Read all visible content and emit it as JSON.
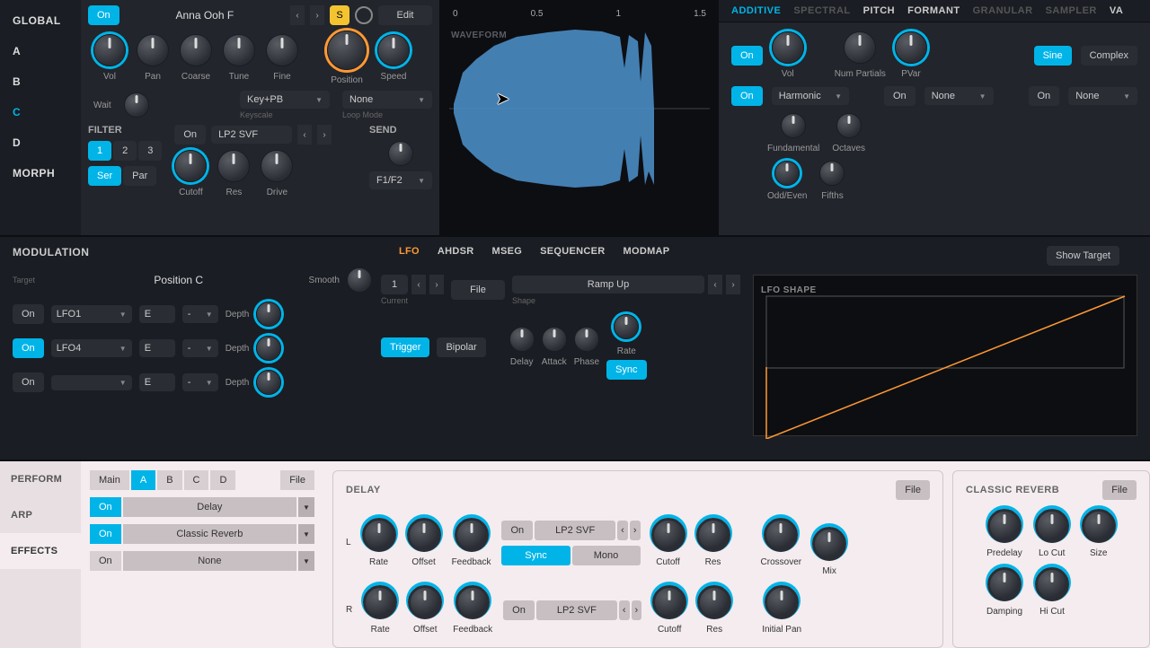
{
  "sidebar": {
    "items": [
      "GLOBAL",
      "A",
      "B",
      "C",
      "D",
      "MORPH"
    ],
    "active": 3
  },
  "source": {
    "on": "On",
    "preset": "Anna Ooh F",
    "s_btn": "S",
    "edit": "Edit",
    "knobs1": [
      "Vol",
      "Pan",
      "Coarse",
      "Tune",
      "Fine",
      "Position",
      "Speed"
    ],
    "wait": "Wait",
    "keyscale": {
      "value": "Key+PB",
      "label": "Keyscale"
    },
    "loopmode": {
      "value": "None",
      "label": "Loop Mode"
    },
    "filter": {
      "title": "FILTER",
      "nums": [
        "1",
        "2",
        "3"
      ],
      "ser": "Ser",
      "par": "Par",
      "on": "On",
      "type": "LP2 SVF",
      "knobs": [
        "Cutoff",
        "Res",
        "Drive"
      ]
    },
    "send": {
      "title": "SEND",
      "route": "F1/F2"
    }
  },
  "waveform": {
    "ticks": [
      "0",
      "0.5",
      "1",
      "1.5"
    ],
    "label": "WAVEFORM"
  },
  "engine": {
    "tabs": [
      "ADDITIVE",
      "SPECTRAL",
      "PITCH",
      "FORMANT",
      "GRANULAR",
      "SAMPLER",
      "VA"
    ],
    "active": 0,
    "mode": {
      "sine": "Sine",
      "complex": "Complex"
    },
    "row1_on": "On",
    "row1_knobs": [
      "Vol",
      "Num Partials",
      "PVar"
    ],
    "row2_on": "On",
    "harmonic": "Harmonic",
    "row2b_on": "On",
    "row2b_val": "None",
    "row2c_on": "On",
    "row2c_val": "None",
    "row3_knobs_a": [
      "Fundamental",
      "Octaves"
    ],
    "row3_knobs_b": [
      "Odd/Even",
      "Fifths"
    ]
  },
  "modulation": {
    "title": "MODULATION",
    "target_label": "Target",
    "target": "Position C",
    "smooth": "Smooth",
    "rows": [
      {
        "on": "On",
        "src": "LFO1",
        "via": "E",
        "op": "-",
        "depth": "Depth"
      },
      {
        "on": "On",
        "src": "LFO4",
        "via": "E",
        "op": "-",
        "depth": "Depth"
      },
      {
        "on": "On",
        "src": "",
        "via": "E",
        "op": "-",
        "depth": "Depth"
      }
    ]
  },
  "lfo": {
    "tabs": [
      "LFO",
      "AHDSR",
      "MSEG",
      "SEQUENCER",
      "MODMAP"
    ],
    "active": 0,
    "show_target": "Show Target",
    "num": "1",
    "file": "File",
    "current": "Current",
    "shape_sel": "Ramp Up",
    "shape_lbl": "Shape",
    "trigger": "Trigger",
    "bipolar": "Bipolar",
    "knobs": [
      "Delay",
      "Attack",
      "Phase",
      "Rate"
    ],
    "sync": "Sync",
    "shape_title": "LFO SHAPE"
  },
  "fx_sidebar": {
    "tabs": [
      "PERFORM",
      "ARP",
      "EFFECTS"
    ],
    "active": 2
  },
  "perform": {
    "tabs": [
      "Main",
      "A",
      "B",
      "C",
      "D"
    ],
    "active": 1,
    "file": "File",
    "rows": [
      {
        "on": "On",
        "name": "Delay",
        "active": true
      },
      {
        "on": "On",
        "name": "Classic Reverb",
        "active": true
      },
      {
        "on": "On",
        "name": "None",
        "active": false
      }
    ]
  },
  "delay": {
    "title": "DELAY",
    "file": "File",
    "L": "L",
    "R": "R",
    "knobs_lr": [
      "Rate",
      "Offset",
      "Feedback"
    ],
    "filter_on": "On",
    "filter_type": "LP2 SVF",
    "sync": "Sync",
    "mono": "Mono",
    "knobs_flt": [
      "Cutoff",
      "Res"
    ],
    "crossover": "Crossover",
    "initial_pan": "Initial Pan",
    "mix": "Mix"
  },
  "reverb": {
    "title": "CLASSIC REVERB",
    "file": "File",
    "knobs1": [
      "Predelay",
      "Lo Cut",
      "Size"
    ],
    "knobs2": [
      "Damping",
      "Hi Cut"
    ]
  }
}
